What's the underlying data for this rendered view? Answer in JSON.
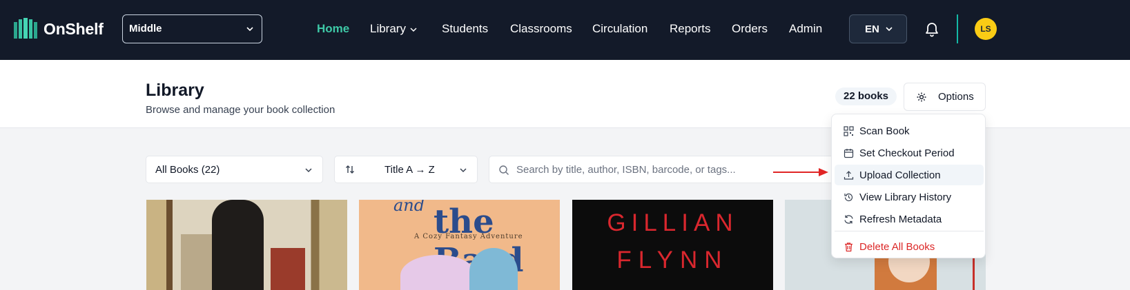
{
  "app": {
    "name": "OnShelf"
  },
  "school_selector": {
    "value": "Middle"
  },
  "nav": {
    "items": [
      {
        "label": "Home",
        "active": true
      },
      {
        "label": "Library",
        "has_dropdown": true
      },
      {
        "label": "Students"
      },
      {
        "label": "Classrooms"
      },
      {
        "label": "Circulation"
      },
      {
        "label": "Reports"
      },
      {
        "label": "Orders"
      },
      {
        "label": "Admin"
      }
    ],
    "language": "EN",
    "avatar_initials": "LS"
  },
  "header": {
    "title": "Library",
    "subtitle": "Browse and manage your book collection",
    "count_badge": "22 books",
    "options_label": "Options"
  },
  "filters": {
    "collection": "All Books (22)",
    "sort": "Title A → Z",
    "search_placeholder": "Search by title, author, ISBN, barcode, or tags..."
  },
  "options_menu": {
    "items": [
      {
        "label": "Scan Book",
        "icon": "qr-scan-icon"
      },
      {
        "label": "Set Checkout Period",
        "icon": "calendar-icon"
      },
      {
        "label": "Upload Collection",
        "icon": "upload-icon",
        "hovered": true
      },
      {
        "label": "View Library History",
        "icon": "history-icon"
      },
      {
        "label": "Refresh Metadata",
        "icon": "refresh-icon"
      },
      {
        "label": "Delete All Books",
        "icon": "trash-icon",
        "danger": true
      }
    ]
  },
  "covers": {
    "cover2": {
      "line1": "and",
      "line2": "the Bard",
      "subtitle": "A Cozy Fantasy Adventure"
    },
    "cover3": {
      "line1": "GILLIAN",
      "line2": "FLYNN"
    }
  },
  "colors": {
    "nav_bg": "#131a29",
    "accent": "#3ec9a7",
    "danger": "#dc2626",
    "avatar": "#facc15",
    "annotation_arrow": "#e02424"
  }
}
